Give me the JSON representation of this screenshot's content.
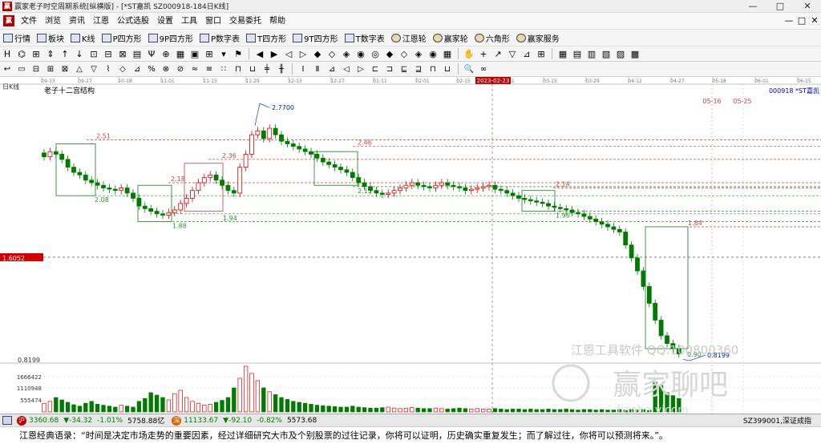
{
  "window": {
    "title": "赢家老子时空周期系统[纵横版] - [*ST嘉凯  SZ000918-184日K线]",
    "logo_text": "赢",
    "buttons": [
      "—",
      "□",
      "✕"
    ]
  },
  "menu": {
    "logo_text": "赢",
    "items": [
      "文件",
      "浏览",
      "资讯",
      "江恩",
      "公式选股",
      "设置",
      "工具",
      "窗口",
      "交易委托",
      "帮助"
    ],
    "mdi_buttons": [
      "—",
      "□",
      "✕"
    ]
  },
  "toolbar1": [
    {
      "label": "行情",
      "icon": "list-icon"
    },
    {
      "label": "板块",
      "icon": "grid-icon"
    },
    {
      "label": "K线",
      "icon": "candle-icon"
    },
    {
      "label": "P四方形",
      "icon": "square-p-icon"
    },
    {
      "label": "9P四方形",
      "icon": "square-9p-icon"
    },
    {
      "label": "P数字表",
      "icon": "table-p-icon"
    },
    {
      "label": "T四方形",
      "icon": "square-t-icon"
    },
    {
      "label": "9T四方形",
      "icon": "square-9t-icon"
    },
    {
      "label": "T数字表",
      "icon": "table-t-icon"
    },
    {
      "label": "江恩轮",
      "icon": "gann-wheel-icon"
    },
    {
      "label": "赢家轮",
      "icon": "winner-wheel-icon"
    },
    {
      "label": "六角形",
      "icon": "hexagon-icon"
    },
    {
      "label": "赢家服务",
      "icon": "dollar-icon"
    }
  ],
  "toolbar2_icons": [
    "H",
    "⌬",
    "⊞",
    "⇕",
    "↑",
    "↓",
    "⊡",
    "⊟",
    "⊠",
    "▤",
    "Ψ",
    "⊕",
    "▦",
    "▣",
    "⊞",
    "▾",
    "⚑",
    "|",
    "◀",
    "▶",
    "◁",
    "▷",
    "◆",
    "◇",
    "◈",
    "◉",
    "◎",
    "◆",
    "◇",
    "◈",
    "◉",
    "▦",
    "|",
    "✋",
    "+",
    "↗",
    "▽",
    "⊿",
    "⊞",
    "|",
    "▦",
    "▤",
    "▥",
    "▧",
    "▨",
    "▩"
  ],
  "toolbar3_icons": [
    "↩",
    "▭",
    "⊟",
    "⊞",
    "⊠",
    "△",
    "▽",
    "⌇",
    "◇",
    "⊿",
    "%",
    "⊗",
    "⊘",
    "≈",
    "≡",
    "∷",
    "⊓",
    "⊔",
    "╪",
    "╫",
    "|",
    "Ⅰ",
    "Ⅱ",
    "⊿",
    "◁",
    "▷",
    "⊏",
    "⊐",
    "⊑",
    "⊒",
    "⊓",
    "⊔",
    "|",
    "🔍",
    "∞"
  ],
  "chart": {
    "period_label": "日K线",
    "structure_label": "老子十二宫结构",
    "stock_code_label": "000918  *ST嘉凯",
    "date_ticks": [
      "09-13",
      "09-27",
      "10-18",
      "11-01",
      "11-15",
      "11-29",
      "12-13",
      "12-27",
      "01-11",
      "02-01",
      "02-15",
      "03-01",
      "03-15",
      "03-29",
      "04-12",
      "04-27",
      "05-18",
      "06-01",
      "06-15"
    ],
    "cursor_date": "2023-02-23",
    "forecast_dates": [
      "05-16",
      "05-25"
    ],
    "price_cursor": "1.6052",
    "price_labels": [
      "2.7700",
      "2.51",
      "2.46",
      "2.36",
      "2.18",
      "2.15",
      "2.14",
      "2.08",
      "1.96",
      "1.94",
      "1.88",
      "1.84",
      "0.90",
      "0.8199"
    ],
    "axis_low": "0.8199",
    "volume_ticks": [
      "1666422",
      "1110948",
      "555474"
    ],
    "watermark_line1": "江恩工具软件  QQ:100800360",
    "watermark_line2": "赢家聊吧",
    "watermark_line3": "liaoba.yjcom",
    "colors": {
      "up": "#d40000",
      "down": "#007a00",
      "guide_red": "#d04040",
      "guide_green": "#2e8b2e",
      "price_tag": "#d00000"
    }
  },
  "status": {
    "sh_icon": "沪",
    "sh_index": "3360.68",
    "sh_change": "▼-34.32",
    "sh_pct": "-1.01%",
    "sh_amount": "5758.88亿",
    "sz_icon": "深",
    "sz_index": "11133.67",
    "sz_change": "▼-92.10",
    "sz_pct": "-0.82%",
    "sz_amount": "5573.68",
    "right_text": "SZ399001,深证成指"
  },
  "quote": "江恩经典语录：“时间是决定市场走势的重要因素，经过详细研究大市及个别股票的过往记录，你将可以证明，历史确实重复发生；而了解过往，你将可以预测将来。”。"
}
